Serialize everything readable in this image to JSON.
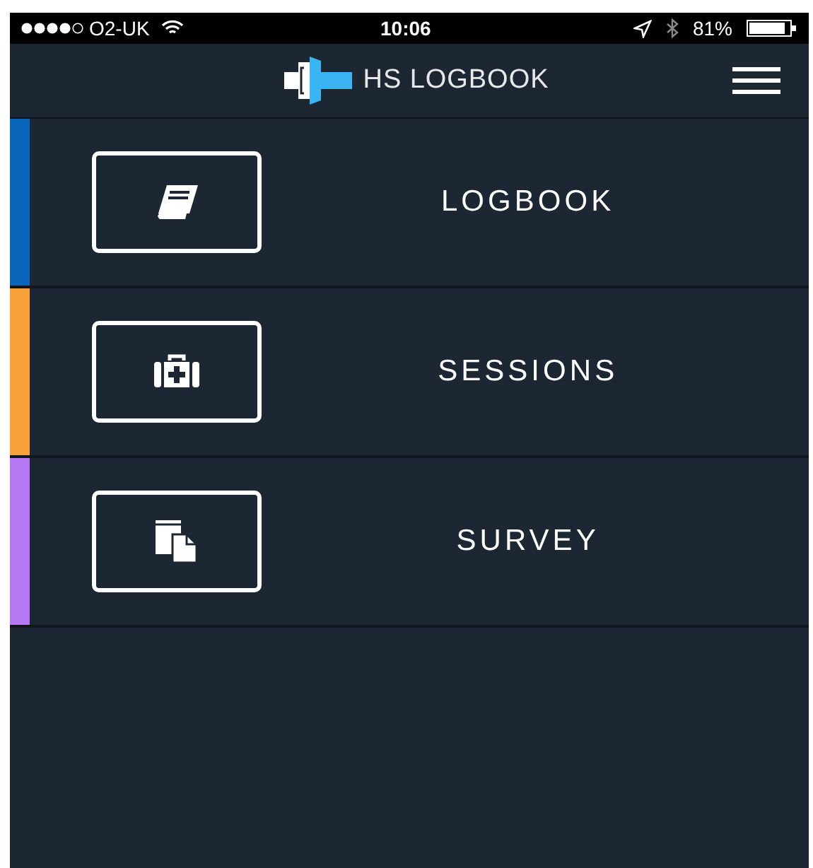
{
  "status_bar": {
    "carrier": "O2-UK",
    "time": "10:06",
    "battery": "81%"
  },
  "header": {
    "title": "HS LOGBOOK"
  },
  "menu_items": [
    {
      "label": "LOGBOOK",
      "color": "#0a66bb",
      "kind": "book"
    },
    {
      "label": "SESSIONS",
      "color": "#f9a23c",
      "kind": "kit"
    },
    {
      "label": "SURVEY",
      "color": "#b877f2",
      "kind": "pages"
    }
  ]
}
